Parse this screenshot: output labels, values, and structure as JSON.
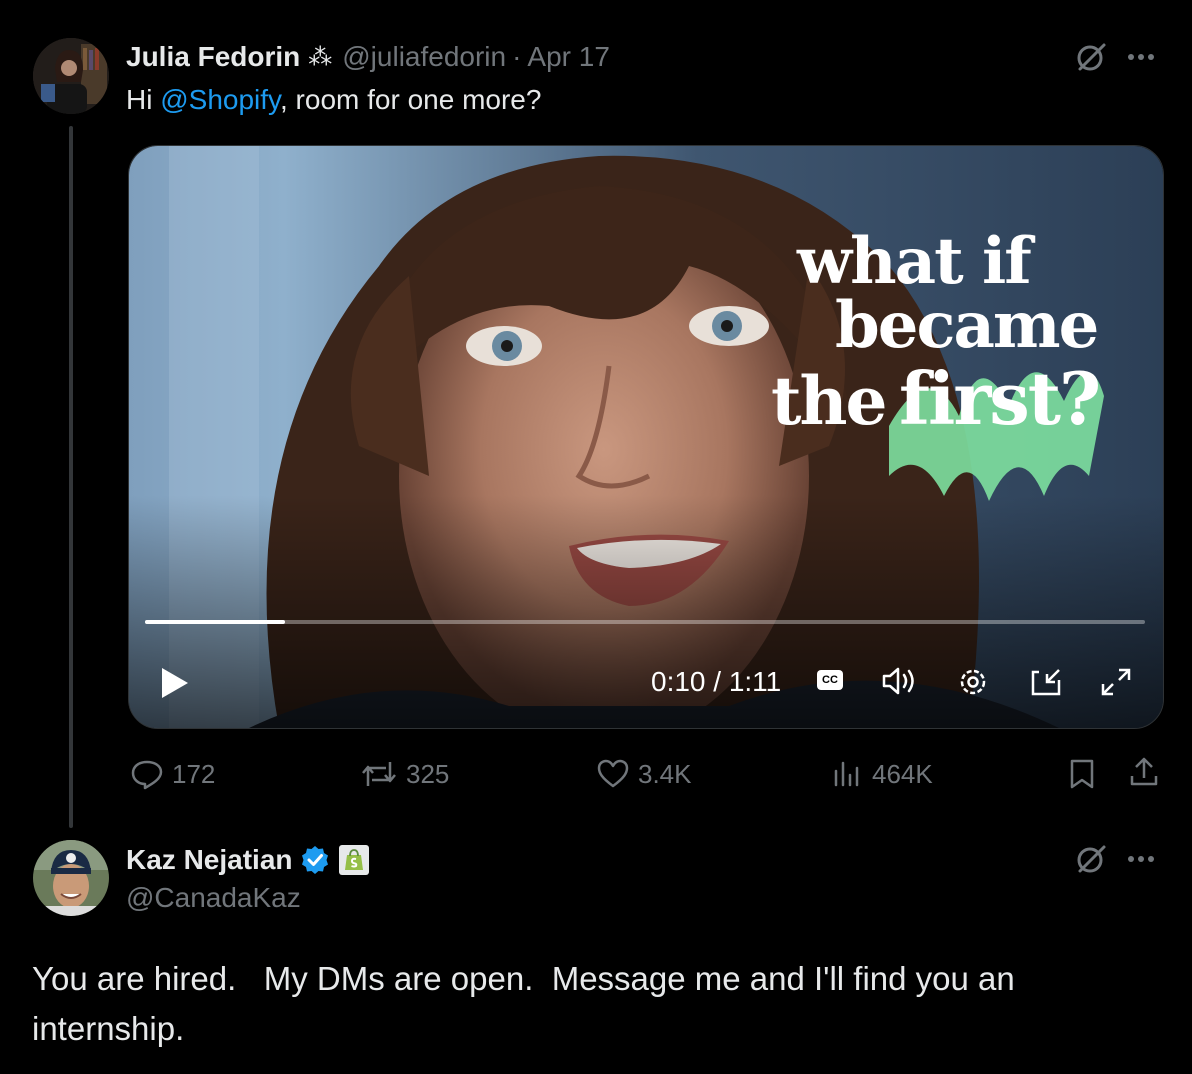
{
  "tweet1": {
    "name": "Julia Fedorin",
    "name_badge": "⁂",
    "handle": "@juliafedorin",
    "separator": "·",
    "date": "Apr 17",
    "text_prefix": "Hi ",
    "mention": "@Shopify",
    "text_suffix": ", room for one more?",
    "video": {
      "overlay_lines": [
        "what if",
        "became",
        "the",
        "first?"
      ],
      "elapsed": "0:10",
      "duration": "1:11",
      "time_display": "0:10 / 1:11",
      "progress": 0.14,
      "cc_label": "CC"
    },
    "stats": {
      "replies": "172",
      "reposts": "325",
      "likes": "3.4K",
      "views": "464K"
    }
  },
  "tweet2": {
    "name": "Kaz Nejatian",
    "handle": "@CanadaKaz",
    "text": "You are hired.   My DMs are open.  Message me and I'll find you an internship."
  },
  "colors": {
    "background": "#000000",
    "text": "#e7e9ea",
    "muted": "#71767b",
    "link": "#1d9bf0",
    "verified": "#1d9bf0",
    "shopify": "#95bf47"
  },
  "icons": [
    "grok-icon",
    "more-icon",
    "play-icon",
    "cc-icon",
    "volume-icon",
    "settings-icon",
    "pip-icon",
    "fullscreen-icon",
    "reply-icon",
    "repost-icon",
    "like-icon",
    "views-icon",
    "bookmark-icon",
    "share-icon",
    "verified-badge-icon",
    "shopify-badge-icon"
  ]
}
